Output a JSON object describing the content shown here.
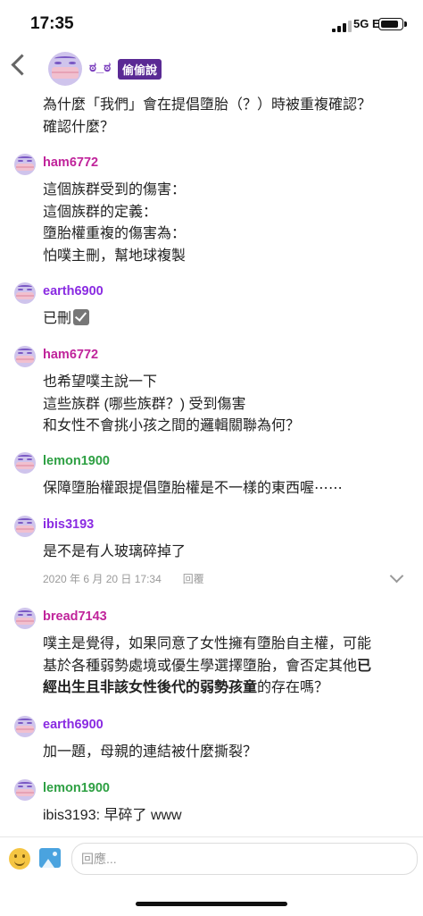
{
  "status": {
    "time": "17:35",
    "network": "5G E"
  },
  "header": {
    "name": "ಠ_ಠ",
    "tag": "偷偷說"
  },
  "comments": [
    {
      "user": "",
      "lines": [
        "為什麼「我們」會在提倡墮胎（？）時被重複確認？",
        "確認什麼？"
      ]
    },
    {
      "user": "ham6772",
      "lines": [
        "這個族群受到的傷害：",
        "這個族群的定義：",
        "墮胎權重複的傷害為：",
        "怕噗主刪，幫地球複製"
      ]
    },
    {
      "user": "earth6900",
      "lines": [
        "已刪"
      ]
    },
    {
      "user": "ham6772",
      "lines": [
        "也希望噗主說一下",
        "這些族群 (哪些族群？) 受到傷害",
        "和女性不會挑小孩之間的邏輯關聯為何？"
      ]
    },
    {
      "user": "lemon1900",
      "lines": [
        "保障墮胎權跟提倡墮胎權是不一樣的東西喔⋯⋯"
      ]
    },
    {
      "user": "ibis3193",
      "lines": [
        "是不是有人玻璃碎掉了"
      ],
      "time": "2020 年 6 月 20 日 17:34",
      "reply": "回覆"
    },
    {
      "user": "bread7143",
      "lines": [
        "噗主是覺得，如果同意了女性擁有墮胎自主權，可能",
        "基於各種弱勢處境或優生學選擇墮胎，會否定其他",
        "出生且非該女性後代的弱勢孩童",
        "的存在嗎？"
      ],
      "bold_prefix": "已",
      "bold_start": "經"
    },
    {
      "user": "earth6900",
      "lines": [
        "加一題，母親的連結被什麼撕裂？"
      ]
    },
    {
      "user": "lemon1900",
      "lines": [
        "ibis3193: 早碎了 www"
      ]
    }
  ],
  "input": {
    "placeholder": "回應..."
  },
  "icons": {
    "emoji": "smile-icon",
    "image": "image-icon",
    "back": "chevron-left-icon",
    "expand": "chevron-down-icon",
    "check": "check-box-icon"
  }
}
